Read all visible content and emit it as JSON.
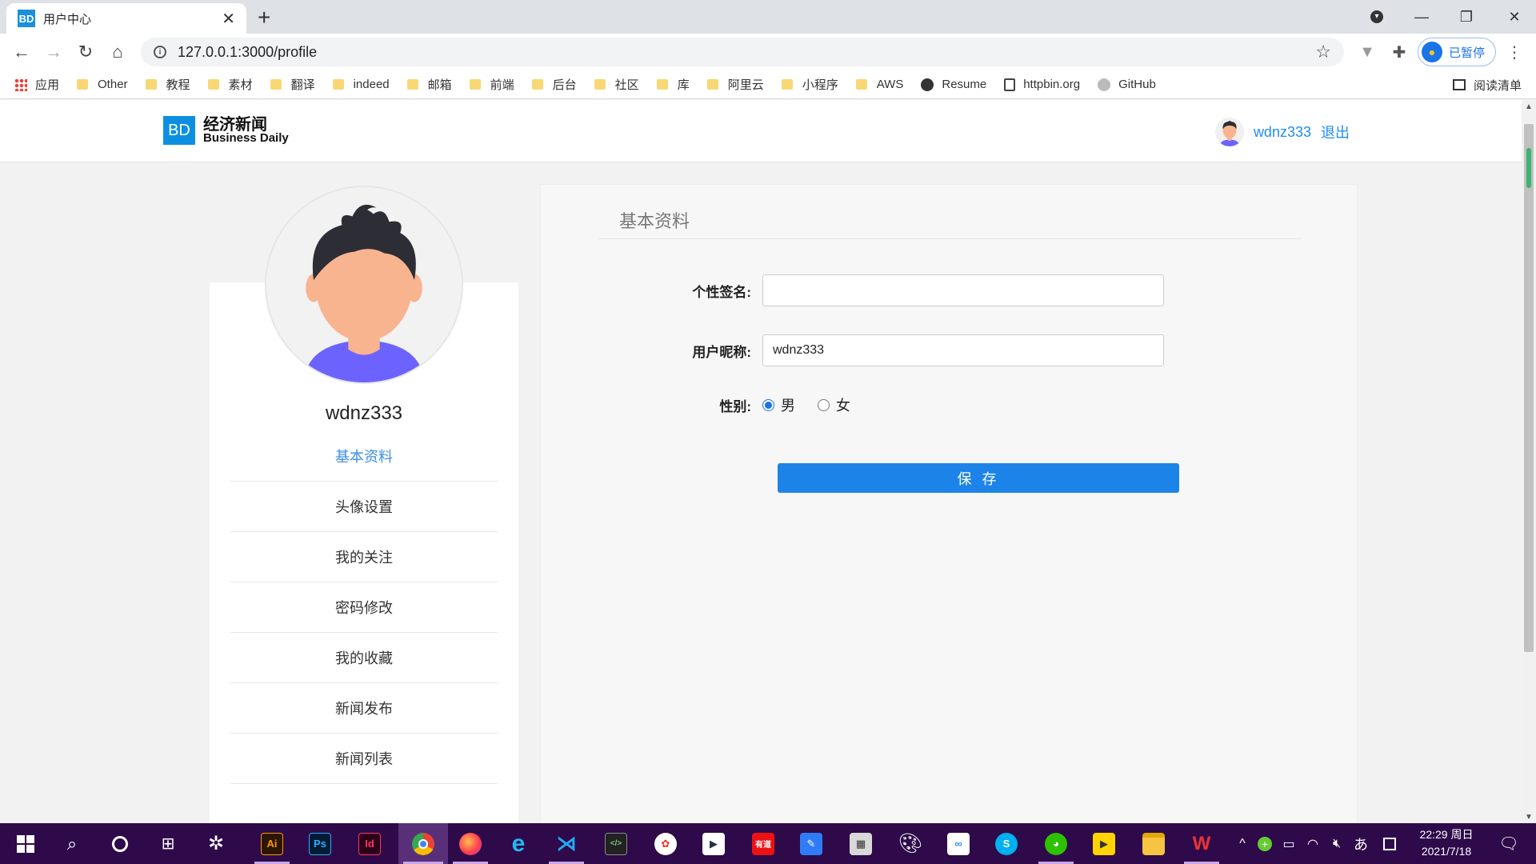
{
  "browser": {
    "tab_title": "用户中心",
    "tab_favicon": "BD",
    "url": "127.0.0.1:3000/profile",
    "profile_status": "已暂停",
    "bookmarks": [
      "应用",
      "Other",
      "教程",
      "素材",
      "翻译",
      "indeed",
      "邮箱",
      "前端",
      "后台",
      "社区",
      "库",
      "阿里云",
      "小程序",
      "AWS",
      "Resume",
      "httpbin.org",
      "GitHub"
    ],
    "reading_list": "阅读清单"
  },
  "site": {
    "logo_badge": "BD",
    "logo_cn": "经济新闻",
    "logo_en": "Business Daily",
    "username": "wdnz333",
    "logout": "退出"
  },
  "sidebar": {
    "username": "wdnz333",
    "items": [
      {
        "label": "基本资料",
        "active": true
      },
      {
        "label": "头像设置"
      },
      {
        "label": "我的关注"
      },
      {
        "label": "密码修改"
      },
      {
        "label": "我的收藏"
      },
      {
        "label": "新闻发布"
      },
      {
        "label": "新闻列表"
      }
    ]
  },
  "form": {
    "title": "基本资料",
    "signature_label": "个性签名:",
    "signature_value": "",
    "nickname_label": "用户昵称:",
    "nickname_value": "wdnz333",
    "gender_label": "性别:",
    "gender_options": [
      "男",
      "女"
    ],
    "gender_selected": "男",
    "save": "保 存"
  },
  "taskbar": {
    "time": "22:29 周日",
    "date": "2021/7/18",
    "ime": "あ"
  },
  "colors": {
    "accent": "#1c84e9",
    "link": "#1f8ef1",
    "logo": "#0d8fe0",
    "taskbar": "#2e0a4a"
  }
}
